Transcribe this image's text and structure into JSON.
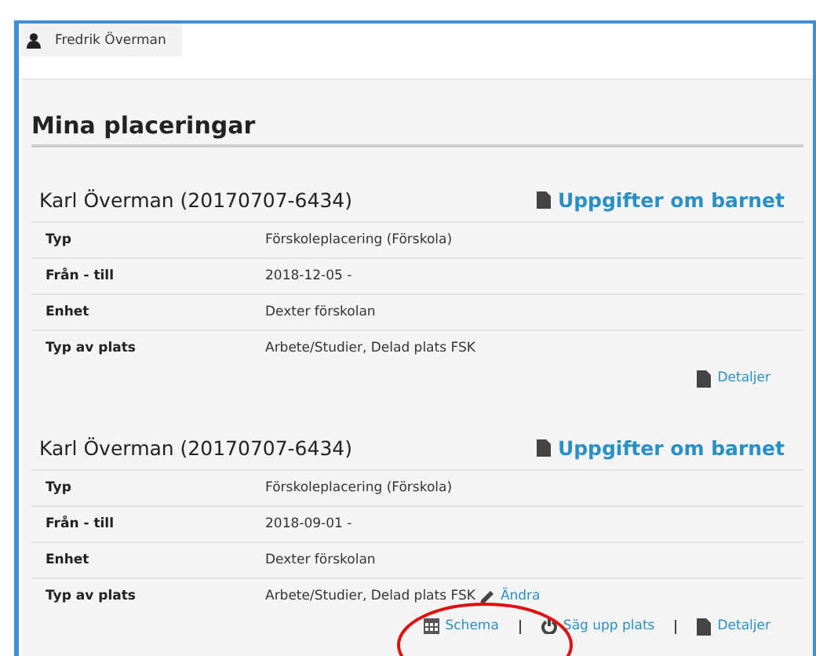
{
  "user": {
    "name": "Fredrik Överman"
  },
  "title": "Mina placeringar",
  "placements": [
    {
      "child": "Karl Överman (20170707-6434)",
      "info_link": "Uppgifter om barnet",
      "rows": [
        {
          "label": "Typ",
          "value": "Förskoleplacering  (Förskola)"
        },
        {
          "label": "Från - till",
          "value": "2018-12-05 -"
        },
        {
          "label": "Enhet",
          "value": "Dexter förskolan"
        },
        {
          "label": "Typ av plats",
          "value": "Arbete/Studier, Delad plats FSK"
        }
      ],
      "actions": [
        {
          "kind": "details",
          "label": "Detaljer"
        }
      ]
    },
    {
      "child": "Karl Överman (20170707-6434)",
      "info_link": "Uppgifter om barnet",
      "rows": [
        {
          "label": "Typ",
          "value": "Förskoleplacering  (Förskola)"
        },
        {
          "label": "Från - till",
          "value": "2018-09-01 -"
        },
        {
          "label": "Enhet",
          "value": "Dexter förskolan"
        },
        {
          "label": "Typ av plats",
          "value": "Arbete/Studier, Delad plats FSK",
          "edit_link": "Ändra"
        }
      ],
      "actions": [
        {
          "kind": "schedule",
          "label": "Schema"
        },
        {
          "kind": "cancel",
          "label": "Säg upp plats"
        },
        {
          "kind": "details",
          "label": "Detaljer"
        }
      ],
      "highlighted": true
    }
  ]
}
